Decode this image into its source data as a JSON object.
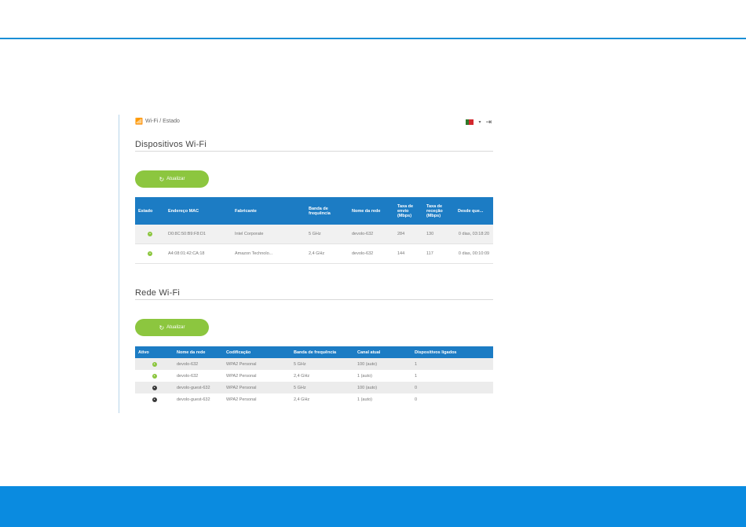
{
  "breadcrumb": {
    "text": "Wi-Fi / Estado"
  },
  "icons": {
    "wifi": "wifi-icon",
    "flag": "portugal-flag-icon",
    "logout": "logout-icon",
    "refresh": "refresh-icon"
  },
  "colors": {
    "accent": "#1a8fd6",
    "header_blue": "#1c7cc4",
    "button_green": "#8cc63f",
    "footer_blue": "#0a8be0"
  },
  "devices": {
    "title": "Dispositivos Wi-Fi",
    "refresh_label": "Atualizar",
    "headers": [
      "Estado",
      "Endereço MAC",
      "Fabricante",
      "Banda de frequência",
      "Nome da rede",
      "Taxa de envio (Mbps)",
      "Taxa de receção (Mbps)",
      "Desde que..."
    ],
    "rows": [
      {
        "status": "on",
        "mac": "D0:8C:50:B9:F8:D1",
        "vendor": "Intel Corporate",
        "band": "5 GHz",
        "ssid": "devolo-632",
        "tx": "284",
        "rx": "130",
        "since": "0 dias, 03:18:20"
      },
      {
        "status": "on",
        "mac": "A4:08:01:42:CA:18",
        "vendor": "Amazon Technolo...",
        "band": "2,4 GHz",
        "ssid": "devolo-632",
        "tx": "144",
        "rx": "117",
        "since": "0 dias, 00:10:09"
      }
    ]
  },
  "networks": {
    "title": "Rede Wi-Fi",
    "refresh_label": "Atualizar",
    "headers": [
      "Ativo",
      "Nome da rede",
      "Codificação",
      "Banda de frequência",
      "Canal atual",
      "Dispositivos ligados"
    ],
    "rows": [
      {
        "active": "on",
        "ssid": "devolo-632",
        "enc": "WPA2 Personal",
        "band": "5 GHz",
        "channel": "100 (auto)",
        "devices": "1"
      },
      {
        "active": "on",
        "ssid": "devolo-632",
        "enc": "WPA2 Personal",
        "band": "2,4 GHz",
        "channel": "1 (auto)",
        "devices": "1"
      },
      {
        "active": "off",
        "ssid": "devolo-guest-632",
        "enc": "WPA2 Personal",
        "band": "5 GHz",
        "channel": "100 (auto)",
        "devices": "0"
      },
      {
        "active": "off",
        "ssid": "devolo-guest-632",
        "enc": "WPA2 Personal",
        "band": "2,4 GHz",
        "channel": "1 (auto)",
        "devices": "0"
      }
    ]
  }
}
